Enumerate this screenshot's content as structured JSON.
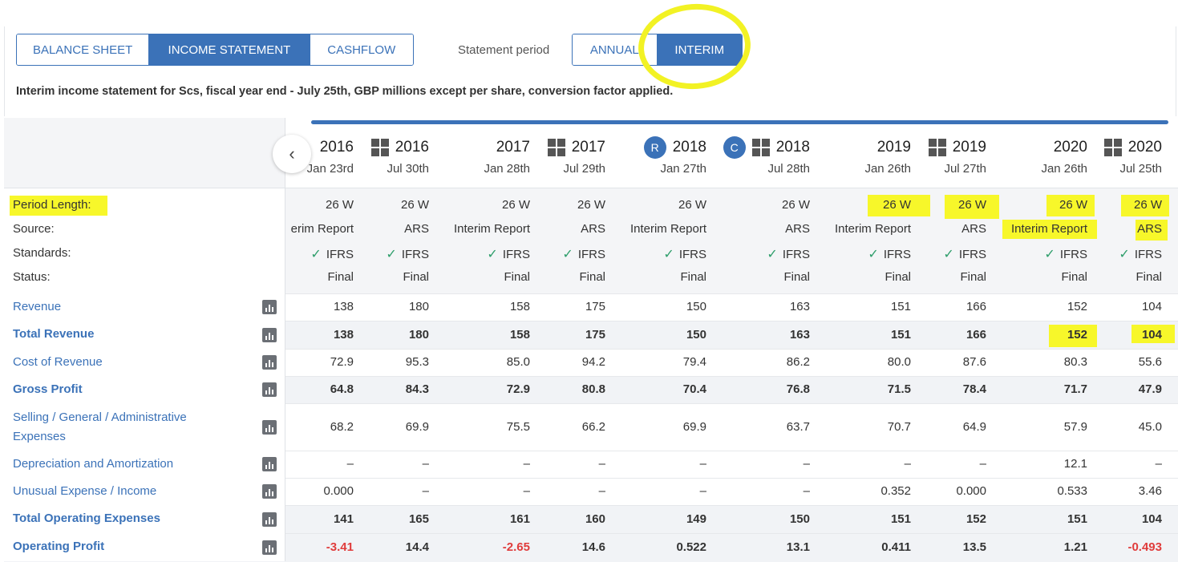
{
  "tabs": [
    "BALANCE SHEET",
    "INCOME STATEMENT",
    "CASHFLOW"
  ],
  "active_tab": "INCOME STATEMENT",
  "statement_period_label": "Statement period",
  "period_options": [
    "ANNUAL",
    "INTERIM"
  ],
  "active_period": "INTERIM",
  "description": "Interim income statement for Scs, fiscal year end - July 25th, GBP millions except per share, conversion factor applied.",
  "nav_left_icon": "chevron-left-icon",
  "columns": [
    {
      "year": "2016",
      "date": "Jan 23rd",
      "badge": "",
      "calc": false
    },
    {
      "year": "2016",
      "date": "Jul 30th",
      "badge": "",
      "calc": true
    },
    {
      "year": "2017",
      "date": "Jan 28th",
      "badge": "",
      "calc": false
    },
    {
      "year": "2017",
      "date": "Jul 29th",
      "badge": "",
      "calc": true
    },
    {
      "year": "2018",
      "date": "Jan 27th",
      "badge": "R",
      "calc": false
    },
    {
      "year": "2018",
      "date": "Jul 28th",
      "badge": "C",
      "calc": true
    },
    {
      "year": "2019",
      "date": "Jan 26th",
      "badge": "",
      "calc": false
    },
    {
      "year": "2019",
      "date": "Jul 27th",
      "badge": "",
      "calc": true
    },
    {
      "year": "2020",
      "date": "Jan 26th",
      "badge": "",
      "calc": false
    },
    {
      "year": "2020",
      "date": "Jul 25th",
      "badge": "",
      "calc": true
    }
  ],
  "meta_labels": {
    "period_length": "Period Length:",
    "source": "Source:",
    "standards": "Standards:",
    "status": "Status:"
  },
  "meta_values": {
    "period_length": [
      "26 W",
      "26 W",
      "26 W",
      "26 W",
      "26 W",
      "26 W",
      "26 W",
      "26 W",
      "26 W",
      "26 W"
    ],
    "source": [
      "erim Report",
      "ARS",
      "Interim Report",
      "ARS",
      "Interim Report",
      "ARS",
      "Interim Report",
      "ARS",
      "Interim Report",
      "ARS"
    ],
    "standards": [
      "IFRS",
      "IFRS",
      "IFRS",
      "IFRS",
      "IFRS",
      "IFRS",
      "IFRS",
      "IFRS",
      "IFRS",
      "IFRS"
    ],
    "status": [
      "Final",
      "Final",
      "Final",
      "Final",
      "Final",
      "Final",
      "Final",
      "Final",
      "Final",
      "Final"
    ]
  },
  "rows": [
    {
      "label": "Revenue",
      "bold": false,
      "values": [
        "138",
        "180",
        "158",
        "175",
        "150",
        "163",
        "151",
        "166",
        "152",
        "104"
      ]
    },
    {
      "label": "Total Revenue",
      "bold": true,
      "values": [
        "138",
        "180",
        "158",
        "175",
        "150",
        "163",
        "151",
        "166",
        "152",
        "104"
      ]
    },
    {
      "label": "Cost of Revenue",
      "bold": false,
      "values": [
        "72.9",
        "95.3",
        "85.0",
        "94.2",
        "79.4",
        "86.2",
        "80.0",
        "87.6",
        "80.3",
        "55.6"
      ]
    },
    {
      "label": "Gross Profit",
      "bold": true,
      "values": [
        "64.8",
        "84.3",
        "72.9",
        "80.8",
        "70.4",
        "76.8",
        "71.5",
        "78.4",
        "71.7",
        "47.9"
      ]
    },
    {
      "label": "Selling / General / Administrative Expenses",
      "bold": false,
      "values": [
        "68.2",
        "69.9",
        "75.5",
        "66.2",
        "69.9",
        "63.7",
        "70.7",
        "64.9",
        "57.9",
        "45.0"
      ]
    },
    {
      "label": "Depreciation and Amortization",
      "bold": false,
      "values": [
        "–",
        "–",
        "–",
        "–",
        "–",
        "–",
        "–",
        "–",
        "12.1",
        "–"
      ]
    },
    {
      "label": "Unusual Expense / Income",
      "bold": false,
      "values": [
        "0.000",
        "–",
        "–",
        "–",
        "–",
        "–",
        "0.352",
        "0.000",
        "0.533",
        "3.46"
      ]
    },
    {
      "label": "Total Operating Expenses",
      "bold": true,
      "values": [
        "141",
        "165",
        "161",
        "160",
        "149",
        "150",
        "151",
        "152",
        "151",
        "104"
      ]
    },
    {
      "label": "Operating Profit",
      "bold": true,
      "values": [
        "-3.41",
        "14.4",
        "-2.65",
        "14.6",
        "0.522",
        "13.1",
        "0.411",
        "13.5",
        "1.21",
        "-0.493"
      ]
    }
  ],
  "colors": {
    "accent": "#3b72b8",
    "negative": "#e03c3c",
    "check": "#2e9e6b",
    "highlight": "#f7f72a"
  }
}
